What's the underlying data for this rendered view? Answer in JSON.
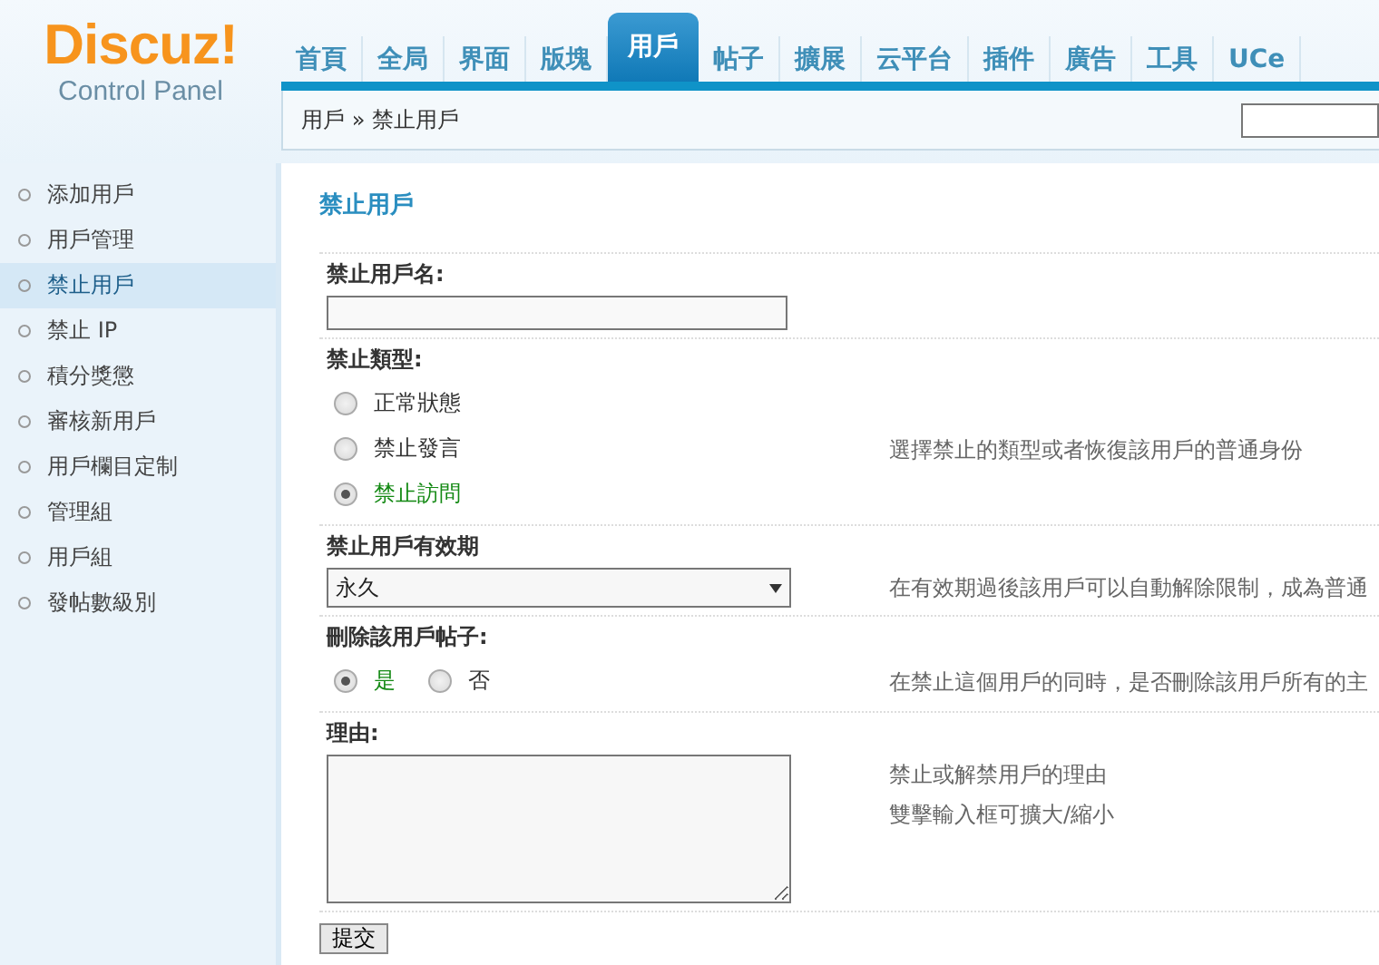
{
  "logo": {
    "brand": "Discuz!",
    "subtitle": "Control Panel"
  },
  "nav_tabs": [
    {
      "label": "首頁",
      "selected": false
    },
    {
      "label": "全局",
      "selected": false
    },
    {
      "label": "界面",
      "selected": false
    },
    {
      "label": "版塊",
      "selected": false
    },
    {
      "label": "用戶",
      "selected": true
    },
    {
      "label": "帖子",
      "selected": false
    },
    {
      "label": "擴展",
      "selected": false
    },
    {
      "label": "云平台",
      "selected": false
    },
    {
      "label": "插件",
      "selected": false
    },
    {
      "label": "廣告",
      "selected": false
    },
    {
      "label": "工具",
      "selected": false
    },
    {
      "label": "UCe",
      "selected": false
    }
  ],
  "breadcrumb": {
    "items": [
      "用戶",
      "禁止用戶"
    ],
    "separator": "»"
  },
  "sidebar": {
    "items": [
      {
        "label": "添加用戶",
        "selected": false
      },
      {
        "label": "用戶管理",
        "selected": false
      },
      {
        "label": "禁止用戶",
        "selected": true
      },
      {
        "label": "禁止 IP",
        "selected": false
      },
      {
        "label": "積分獎懲",
        "selected": false
      },
      {
        "label": "審核新用戶",
        "selected": false
      },
      {
        "label": "用戶欄目定制",
        "selected": false
      },
      {
        "label": "管理組",
        "selected": false
      },
      {
        "label": "用戶組",
        "selected": false
      },
      {
        "label": "發帖數級別",
        "selected": false
      }
    ]
  },
  "page_title": "禁止用戶",
  "form": {
    "rows": [
      {
        "kind": "text",
        "label": "禁止用戶名:"
      },
      {
        "kind": "radio",
        "label": "禁止類型:",
        "options": [
          {
            "label": "正常狀態",
            "selected": false
          },
          {
            "label": "禁止發言",
            "selected": false
          },
          {
            "label": "禁止訪問",
            "selected": true
          }
        ],
        "hint": "選擇禁止的類型或者恢復該用戶的普通身份"
      },
      {
        "kind": "select",
        "label": "禁止用戶有效期",
        "value": "永久",
        "hint": "在有效期過後該用戶可以自動解除限制，成為普通"
      },
      {
        "kind": "inline-radio",
        "label": "刪除該用戶帖子:",
        "options": [
          {
            "label": "是",
            "selected": true
          },
          {
            "label": "否",
            "selected": false
          }
        ],
        "hint": "在禁止這個用戶的同時，是否刪除該用戶所有的主"
      },
      {
        "kind": "textarea",
        "label": "理由:",
        "hints": [
          "禁止或解禁用戶的理由",
          "雙擊輸入框可擴大/縮小"
        ]
      }
    ],
    "submit": "提交"
  }
}
